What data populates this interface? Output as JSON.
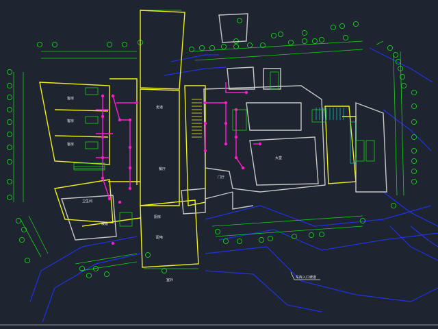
{
  "colors": {
    "background": "#1e2430",
    "wall": "#f2f21a",
    "dimension": "#19d219",
    "electrical": "#ff1ccc",
    "site": "#2232e6",
    "label": "#e8e8e8",
    "grey_wall": "#c8c8c8",
    "cyan": "#1ad2d2"
  },
  "drawing": {
    "type": "architectural floor plan (CAD)",
    "rooms": [
      {
        "id": "r1",
        "label": "客房"
      },
      {
        "id": "r2",
        "label": "客房"
      },
      {
        "id": "r3",
        "label": "客房"
      },
      {
        "id": "r4",
        "label": "走道"
      },
      {
        "id": "r5",
        "label": "大堂"
      },
      {
        "id": "r6",
        "label": "餐厅"
      },
      {
        "id": "r7",
        "label": "厨房"
      },
      {
        "id": "r8",
        "label": "门厅"
      },
      {
        "id": "r9",
        "label": "配电"
      },
      {
        "id": "r10",
        "label": "卫生间"
      },
      {
        "id": "r11",
        "label": "坡道"
      }
    ],
    "bottom_label": "室外",
    "note_label": "车库入口坡道"
  }
}
